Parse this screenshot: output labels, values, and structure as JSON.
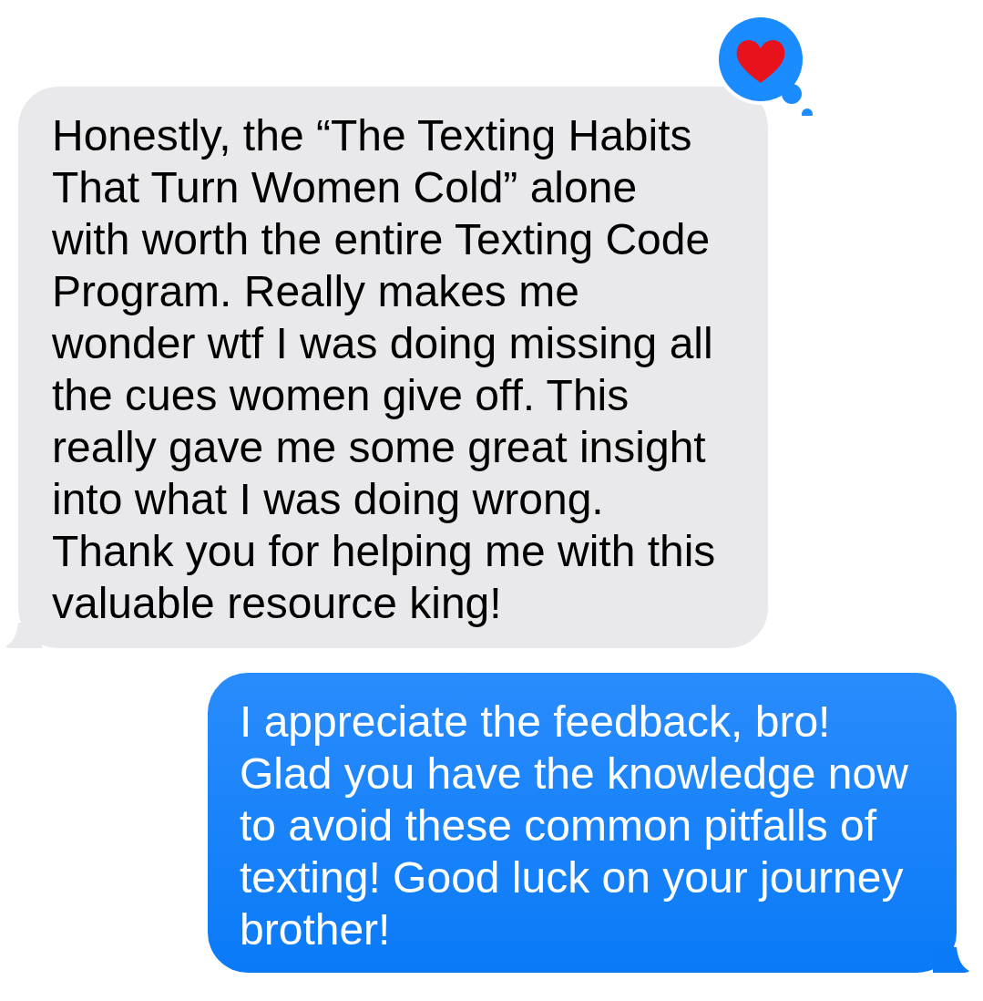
{
  "messages": [
    {
      "kind": "incoming",
      "heart_reaction": true,
      "lines": [
        "Honestly, the “The Texting Habits",
        "That Turn Women Cold” alone",
        "with worth the entire Texting Code",
        "Program. Really makes me",
        "wonder wtf I was doing missing all",
        "the cues women give off. This",
        "really gave me some great insight",
        "into what I was doing wrong.",
        "Thank you for helping me with this",
        "valuable resource king!"
      ]
    },
    {
      "kind": "outgoing",
      "lines": [
        "I appreciate the feedback, bro!",
        "Glad you have the knowledge now",
        "to avoid these common pitfalls of",
        "texting! Good luck on your journey",
        "brother!"
      ]
    }
  ]
}
